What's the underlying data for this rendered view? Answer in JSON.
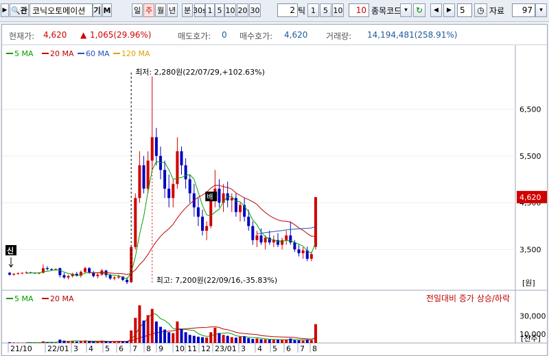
{
  "toolbar": {
    "stock_name": "코닉오토메이션",
    "name_btn_1": "기",
    "name_btn_2": "M",
    "period_tabs": [
      "일",
      "주",
      "월",
      "년",
      "분",
      "30s",
      "1",
      "5",
      "10",
      "20",
      "30"
    ],
    "active_period": "주",
    "tick_value": "2",
    "tick_label": "틱",
    "tick_tabs": [
      "1",
      "5",
      "10"
    ],
    "tick_custom": "10",
    "code_label": "종목코드",
    "count_value": "5",
    "data_label": "자료",
    "data_value": "97"
  },
  "info": {
    "current_label": "현재가:",
    "current_value": "4,620",
    "change_value": "1,065(29.96%)",
    "ask_label": "매도호가:",
    "ask_value": "0",
    "bid_label": "매수호가:",
    "bid_value": "4,620",
    "volume_label": "거래량:",
    "volume_value": "14,194,481(258.91%)"
  },
  "colors": {
    "up": "#d00000",
    "down": "#0000c0",
    "ma5": "#00a000",
    "ma20": "#c00000",
    "ma60": "#2050c0",
    "ma120": "#e0a000"
  },
  "chart_data": {
    "type": "candlestick",
    "legend": [
      "5 MA",
      "20 MA",
      "60 MA",
      "120 MA"
    ],
    "volume_legend": [
      "5 MA",
      "20 MA"
    ],
    "volume_note": "전일대비 증가 상승/하락",
    "y_ticks": [
      6500,
      5500,
      4500,
      3500
    ],
    "y_unit": "[원]",
    "ylim": [
      2700,
      7400
    ],
    "volume_ticks": [
      30000,
      10000
    ],
    "volume_unit": "[천주]",
    "volume_max": 42000,
    "current_price": 4620,
    "current_price_label": "4,620",
    "x_labels": [
      "21/10",
      "22/01",
      "3",
      "4",
      "5",
      "6",
      "7",
      "8",
      "9",
      "10",
      "11",
      "12",
      "23/01",
      "3",
      "4",
      "5",
      "6",
      "7",
      "8"
    ],
    "annotations": {
      "listing": "신",
      "high": "최저: 2,280원(22/07/29,+102.63%)",
      "low": "최고: 7,200원(22/09/16,-35.83%)",
      "marker": "배"
    },
    "candles": [
      [
        3000,
        3020,
        2940,
        2960
      ],
      [
        2960,
        2990,
        2940,
        2980
      ],
      [
        2980,
        3010,
        2960,
        2990
      ],
      [
        2990,
        3010,
        2970,
        3000
      ],
      [
        3000,
        3030,
        2980,
        3010
      ],
      [
        3010,
        3020,
        2990,
        3000
      ],
      [
        3000,
        3010,
        2980,
        2990
      ],
      [
        2990,
        3010,
        2970,
        3000
      ],
      [
        3000,
        3180,
        2990,
        3100
      ],
      [
        3100,
        3140,
        3050,
        3080
      ],
      [
        3080,
        3100,
        3050,
        3070
      ],
      [
        3070,
        3100,
        3050,
        3080
      ],
      [
        3100,
        3110,
        2900,
        2950
      ],
      [
        2950,
        3000,
        2870,
        2900
      ],
      [
        2900,
        2960,
        2860,
        2930
      ],
      [
        2930,
        3000,
        2900,
        2980
      ],
      [
        2980,
        3020,
        2920,
        2940
      ],
      [
        2940,
        3050,
        2900,
        3020
      ],
      [
        3020,
        3130,
        3000,
        3100
      ],
      [
        3100,
        3120,
        2980,
        3000
      ],
      [
        3000,
        3040,
        2900,
        2930
      ],
      [
        2930,
        3000,
        2880,
        2960
      ],
      [
        2960,
        3080,
        2940,
        3050
      ],
      [
        3050,
        3060,
        2900,
        2950
      ],
      [
        2950,
        2980,
        2850,
        2880
      ],
      [
        2880,
        2930,
        2840,
        2900
      ],
      [
        2900,
        2960,
        2870,
        2920
      ],
      [
        2920,
        2930,
        2820,
        2850
      ],
      [
        2850,
        2900,
        2760,
        2800
      ],
      [
        2800,
        3600,
        2780,
        3550
      ],
      [
        3550,
        4700,
        3500,
        4600
      ],
      [
        4600,
        5600,
        4500,
        5300
      ],
      [
        5300,
        5500,
        4700,
        4800
      ],
      [
        4800,
        5600,
        4700,
        5400
      ],
      [
        5400,
        7200,
        5200,
        5900
      ],
      [
        5900,
        6100,
        5300,
        5500
      ],
      [
        5500,
        5700,
        5000,
        5200
      ],
      [
        5200,
        5400,
        4600,
        4800
      ],
      [
        4800,
        5100,
        4400,
        4600
      ],
      [
        4600,
        5000,
        4400,
        4900
      ],
      [
        4900,
        5900,
        4800,
        5600
      ],
      [
        5600,
        5700,
        5100,
        5300
      ],
      [
        5300,
        5450,
        4800,
        5000
      ],
      [
        5000,
        5100,
        4500,
        4700
      ],
      [
        4700,
        4900,
        4200,
        4400
      ],
      [
        4400,
        4600,
        4000,
        4200
      ],
      [
        4200,
        4350,
        3800,
        3900
      ],
      [
        3900,
        4100,
        3700,
        4000
      ],
      [
        4000,
        4700,
        3950,
        4600
      ],
      [
        4600,
        5200,
        4400,
        4800
      ],
      [
        4800,
        5000,
        4400,
        4500
      ],
      [
        4500,
        4900,
        4300,
        4700
      ],
      [
        4700,
        4950,
        4400,
        4550
      ],
      [
        4550,
        4700,
        4300,
        4600
      ],
      [
        4600,
        4700,
        4200,
        4300
      ],
      [
        4300,
        4500,
        4100,
        4450
      ],
      [
        4450,
        4600,
        4100,
        4200
      ],
      [
        4200,
        4350,
        3900,
        4000
      ],
      [
        4000,
        4100,
        3600,
        3700
      ],
      [
        3700,
        3900,
        3550,
        3800
      ],
      [
        3800,
        3950,
        3600,
        3650
      ],
      [
        3650,
        3800,
        3500,
        3750
      ],
      [
        3750,
        3900,
        3600,
        3650
      ],
      [
        3650,
        3800,
        3550,
        3700
      ],
      [
        3700,
        3850,
        3550,
        3600
      ],
      [
        3600,
        3750,
        3500,
        3700
      ],
      [
        3700,
        3900,
        3600,
        3800
      ],
      [
        3800,
        4100,
        3600,
        3650
      ],
      [
        3650,
        3700,
        3450,
        3500
      ],
      [
        3500,
        3600,
        3350,
        3420
      ],
      [
        3420,
        3550,
        3300,
        3480
      ],
      [
        3480,
        3560,
        3250,
        3300
      ],
      [
        3300,
        3450,
        3250,
        3400
      ],
      [
        3555,
        4620,
        3500,
        4620
      ]
    ],
    "volumes": [
      900,
      600,
      500,
      400,
      500,
      300,
      300,
      400,
      1800,
      900,
      600,
      500,
      3800,
      2600,
      2200,
      1900,
      1600,
      2400,
      2800,
      2100,
      1700,
      1500,
      2600,
      1900,
      1400,
      1500,
      1700,
      1600,
      1800,
      14000,
      28000,
      42000,
      25000,
      31000,
      38000,
      24000,
      18000,
      15000,
      12000,
      11000,
      24000,
      16000,
      12000,
      9000,
      8000,
      7000,
      6500,
      6000,
      12000,
      17000,
      11000,
      9000,
      8000,
      6500,
      6000,
      7000,
      7500,
      5500,
      4500,
      5000,
      4200,
      4000,
      3800,
      3500,
      3600,
      3400,
      3800,
      5000,
      3200,
      3000,
      2800,
      3600,
      3000,
      21000
    ]
  }
}
